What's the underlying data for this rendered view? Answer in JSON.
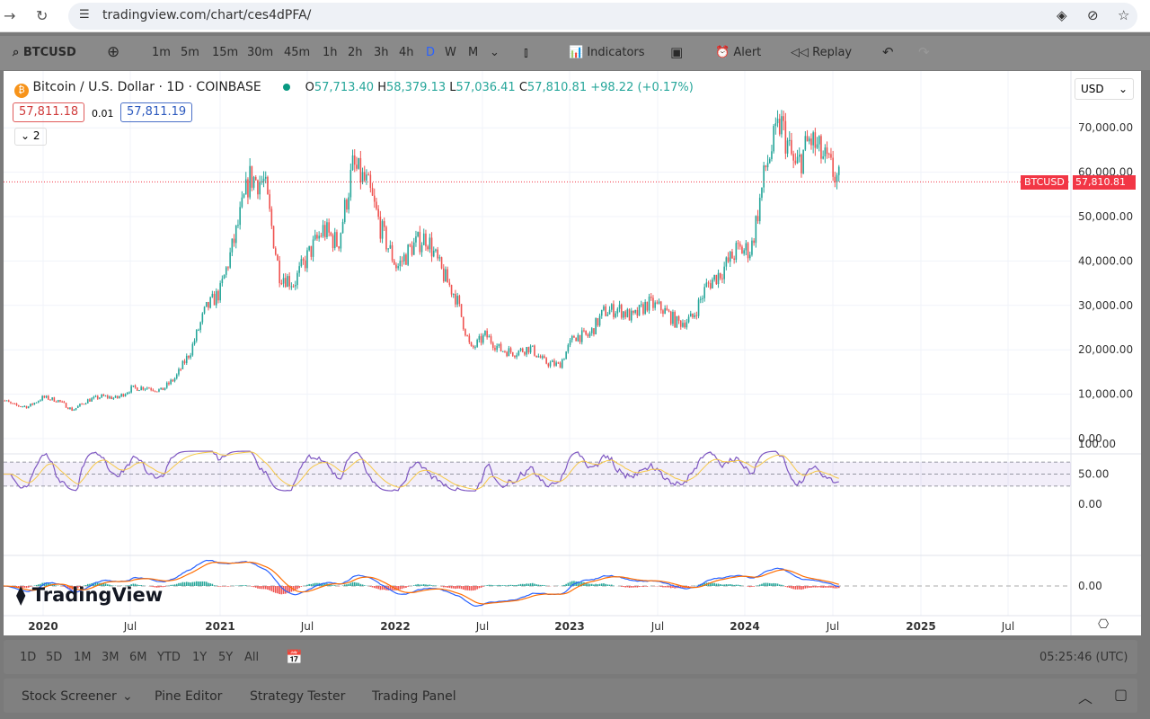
{
  "browser": {
    "url": "tradingview.com/chart/ces4dPFA/"
  },
  "toolbar": {
    "symbol": "BTCUSD",
    "intervals": [
      "1m",
      "5m",
      "15m",
      "30m",
      "45m",
      "1h",
      "2h",
      "3h",
      "4h",
      "D",
      "W",
      "M"
    ],
    "active_interval": "D",
    "indicators": "Indicators",
    "alert": "Alert",
    "replay": "Replay"
  },
  "legend": {
    "title": "Bitcoin / U.S. Dollar · 1D · COINBASE",
    "o_label": "O",
    "o": "57,713.40",
    "h_label": "H",
    "h": "58,379.13",
    "l_label": "L",
    "l": "57,036.41",
    "c_label": "C",
    "c": "57,810.81",
    "change": "+98.22 (+0.17%)",
    "sell": "57,811.18",
    "spread": "0.01",
    "buy": "57,811.19",
    "collapse": "2"
  },
  "currency": "USD",
  "price_tag": {
    "symbol": "BTCUSD",
    "price": "57,810.81"
  },
  "watermark": "TradingView",
  "timezone": "05:25:46 (UTC)",
  "ranges": [
    "1D",
    "5D",
    "1M",
    "3M",
    "6M",
    "YTD",
    "1Y",
    "5Y",
    "All"
  ],
  "panels": [
    "Stock Screener",
    "Pine Editor",
    "Strategy Tester",
    "Trading Panel"
  ],
  "colors": {
    "up": "#26a69a",
    "down": "#ef5350",
    "rsi": "#7e57c2",
    "macd": "#2962ff",
    "signal": "#ff6d00"
  },
  "chart_data": {
    "type": "candlestick",
    "price_axis": {
      "ticks": [
        "70,000.00",
        "60,000.00",
        "50,000.00",
        "40,000.00",
        "30,000.00",
        "20,000.00",
        "10,000.00",
        "0.00"
      ],
      "ylim": [
        0,
        72000
      ]
    },
    "rsi_axis": {
      "ticks": [
        "100.00",
        "50.00",
        "0.00"
      ],
      "bands": [
        70,
        30
      ]
    },
    "macd_axis": {
      "ticks": [
        "0.00"
      ]
    },
    "x_ticks": [
      "2020",
      "Jul",
      "2021",
      "Jul",
      "2022",
      "Jul",
      "2023",
      "Jul",
      "2024",
      "Jul",
      "2025",
      "Jul"
    ],
    "monthly_close": [
      [
        "2019-10",
        9200
      ],
      [
        "2019-11",
        7500
      ],
      [
        "2019-12",
        7200
      ],
      [
        "2020-01",
        9300
      ],
      [
        "2020-02",
        8600
      ],
      [
        "2020-03",
        6400
      ],
      [
        "2020-04",
        8600
      ],
      [
        "2020-05",
        9500
      ],
      [
        "2020-06",
        9100
      ],
      [
        "2020-07",
        11300
      ],
      [
        "2020-08",
        11600
      ],
      [
        "2020-09",
        10800
      ],
      [
        "2020-10",
        13800
      ],
      [
        "2020-11",
        19700
      ],
      [
        "2020-12",
        29000
      ],
      [
        "2021-01",
        33100
      ],
      [
        "2021-02",
        45200
      ],
      [
        "2021-03",
        58800
      ],
      [
        "2021-04",
        57700
      ],
      [
        "2021-05",
        37300
      ],
      [
        "2021-06",
        35000
      ],
      [
        "2021-07",
        41500
      ],
      [
        "2021-08",
        47100
      ],
      [
        "2021-09",
        43800
      ],
      [
        "2021-10",
        61300
      ],
      [
        "2021-11",
        57000
      ],
      [
        "2021-12",
        46300
      ],
      [
        "2022-01",
        38500
      ],
      [
        "2022-02",
        43200
      ],
      [
        "2022-03",
        45500
      ],
      [
        "2022-04",
        37700
      ],
      [
        "2022-05",
        31800
      ],
      [
        "2022-06",
        19900
      ],
      [
        "2022-07",
        23300
      ],
      [
        "2022-08",
        20000
      ],
      [
        "2022-09",
        19400
      ],
      [
        "2022-10",
        20500
      ],
      [
        "2022-11",
        17200
      ],
      [
        "2022-12",
        16500
      ],
      [
        "2023-01",
        23100
      ],
      [
        "2023-02",
        23100
      ],
      [
        "2023-03",
        28500
      ],
      [
        "2023-04",
        29200
      ],
      [
        "2023-05",
        27200
      ],
      [
        "2023-06",
        30500
      ],
      [
        "2023-07",
        29200
      ],
      [
        "2023-08",
        26000
      ],
      [
        "2023-09",
        27000
      ],
      [
        "2023-10",
        34500
      ],
      [
        "2023-11",
        37700
      ],
      [
        "2023-12",
        42300
      ],
      [
        "2024-01",
        42600
      ],
      [
        "2024-02",
        61200
      ],
      [
        "2024-03",
        71300
      ],
      [
        "2024-04",
        60600
      ],
      [
        "2024-05",
        67500
      ],
      [
        "2024-06",
        62700
      ],
      [
        "2024-07",
        57800
      ]
    ]
  }
}
